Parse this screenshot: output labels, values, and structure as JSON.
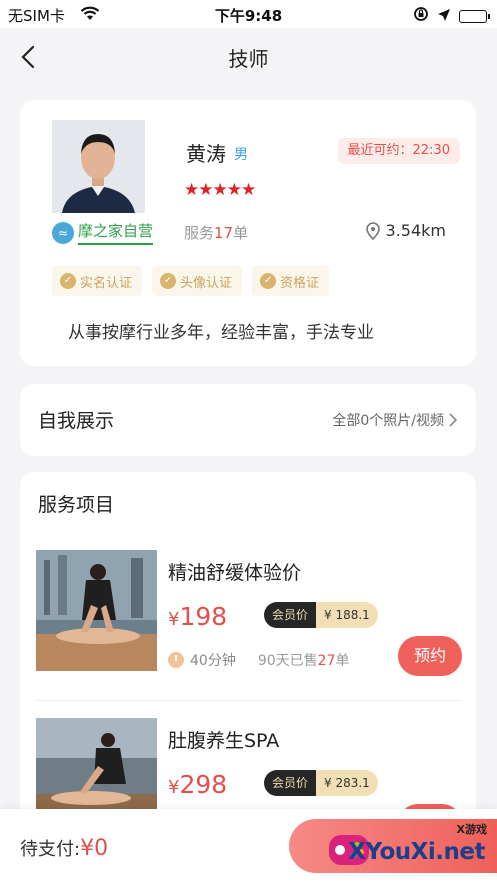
{
  "status_bar": {
    "carrier": "无SIM卡",
    "time": "下午9:48"
  },
  "nav": {
    "title": "技师"
  },
  "technician": {
    "name": "黄涛",
    "gender": "男",
    "availability": "最近可约：22:30",
    "rating_stars": 5,
    "brand": "摩之家自营",
    "service_prefix": "服务",
    "service_count": "17",
    "service_suffix": "单",
    "distance": "3.54km",
    "certifications": [
      "实名认证",
      "头像认证",
      "资格证"
    ],
    "intro": "从事按摩行业多年，经验丰富，手法专业"
  },
  "showcase": {
    "title": "自我展示",
    "link": "全部0个照片/视频"
  },
  "services": {
    "title": "服务项目",
    "member_label": "会员价",
    "book_label": "预约",
    "items": [
      {
        "name": "精油舒缓体验价",
        "price": "198",
        "member_price": "¥ 188.1",
        "duration": "40分钟",
        "sold_prefix": "90天已售",
        "sold_count": "27",
        "sold_suffix": "单"
      },
      {
        "name": "肚腹养生SPA",
        "price": "298",
        "member_price": "¥ 283.1",
        "duration": "",
        "sold_prefix": "",
        "sold_count": "",
        "sold_suffix": ""
      }
    ]
  },
  "bottom_bar": {
    "pending_label": "待支付:",
    "pending_amount": "¥0"
  },
  "watermark": {
    "small": "X游戏",
    "big": "XYouXi.net"
  },
  "colors": {
    "accent": "#f0605a",
    "price": "#e0514b",
    "brand_green": "#2f9e4a",
    "gold": "#d8b56e"
  }
}
